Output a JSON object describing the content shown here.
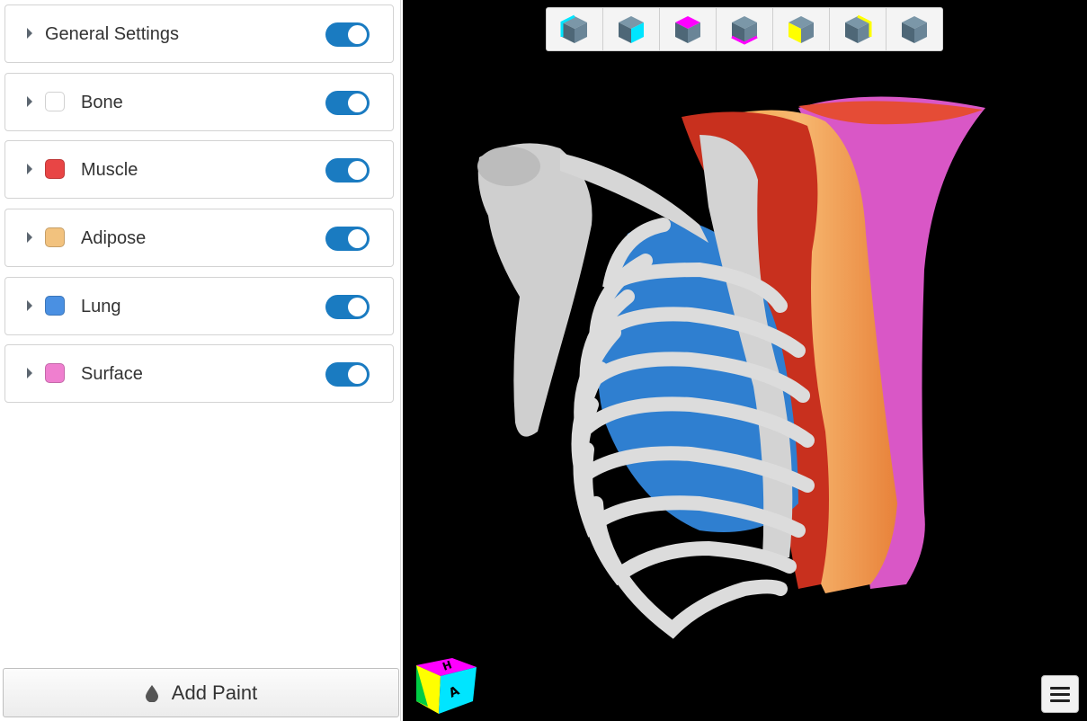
{
  "layers": [
    {
      "label": "General Settings",
      "swatch": null,
      "enabled": true
    },
    {
      "label": "Bone",
      "swatch": "#ffffff",
      "enabled": true
    },
    {
      "label": "Muscle",
      "swatch": "#e84545",
      "enabled": true
    },
    {
      "label": "Adipose",
      "swatch": "#f2c27e",
      "enabled": true
    },
    {
      "label": "Lung",
      "swatch": "#4a90e2",
      "enabled": true
    },
    {
      "label": "Surface",
      "swatch": "#ef7fcf",
      "enabled": true
    }
  ],
  "add_paint": {
    "label": "Add Paint",
    "icon": "droplet-icon"
  },
  "view_toolbar": [
    {
      "name": "view-left-cyan",
      "accent": "#00e5ff"
    },
    {
      "name": "view-right-cyan",
      "accent": "#00e5ff"
    },
    {
      "name": "view-top-magenta",
      "accent": "#ff00ff"
    },
    {
      "name": "view-bottom-magenta",
      "accent": "#ff00ff"
    },
    {
      "name": "view-front-yellow",
      "accent": "#ffff00"
    },
    {
      "name": "view-back-yellow",
      "accent": "#ffff00"
    },
    {
      "name": "view-reset",
      "accent": null
    }
  ],
  "orientation_cube": {
    "top_label": "H",
    "front_label": "A"
  },
  "colors": {
    "toggle_on": "#1a7bc1",
    "viewer_background": "#000000"
  }
}
